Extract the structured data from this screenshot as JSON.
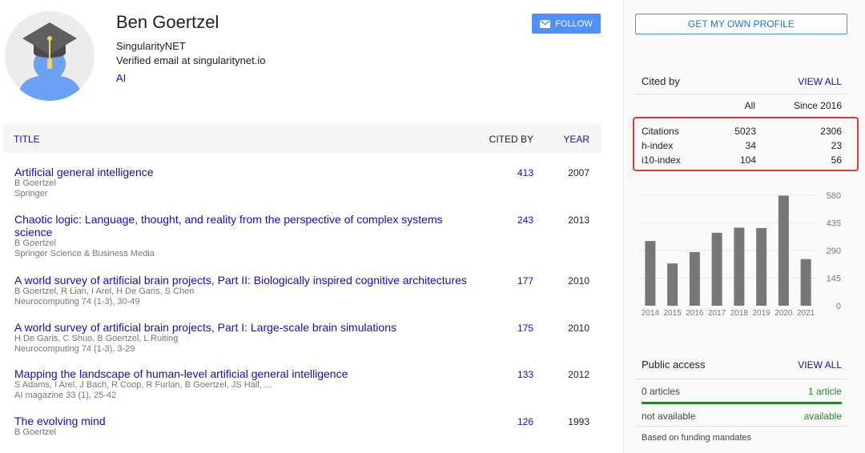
{
  "profile": {
    "name": "Ben Goertzel",
    "affiliation": "SingularityNET",
    "email": "Verified email at singularitynet.io",
    "interest": "AI",
    "follow_label": "FOLLOW"
  },
  "table": {
    "col_title": "TITLE",
    "col_cited": "CITED BY",
    "col_year": "YEAR",
    "articles": [
      {
        "title": "Artificial general intelligence",
        "authors": "B Goertzel",
        "venue": "Springer",
        "cited": "413",
        "year": "2007"
      },
      {
        "title": "Chaotic logic: Language, thought, and reality from the perspective of complex systems science",
        "authors": "B Goertzel",
        "venue": "Springer Science & Business Media",
        "cited": "243",
        "year": "2013"
      },
      {
        "title": "A world survey of artificial brain projects, Part II: Biologically inspired cognitive architectures",
        "authors": "B Goertzel, R Lian, I Arel, H De Garis, S Chen",
        "venue": "Neurocomputing 74 (1-3), 30-49",
        "cited": "177",
        "year": "2010"
      },
      {
        "title": "A world survey of artificial brain projects, Part I: Large-scale brain simulations",
        "authors": "H De Garis, C Shuo, B Goertzel, L Ruiting",
        "venue": "Neurocomputing 74 (1-3), 3-29",
        "cited": "175",
        "year": "2010"
      },
      {
        "title": "Mapping the landscape of human-level artificial general intelligence",
        "authors": "S Adams, I Arel, J Bach, R Coop, R Furlan, B Goertzel, JS Hall, ...",
        "venue": "AI magazine 33 (1), 25-42",
        "cited": "133",
        "year": "2012"
      },
      {
        "title": "The evolving mind",
        "authors": "B Goertzel",
        "venue": "",
        "cited": "126",
        "year": "1993"
      }
    ]
  },
  "sidebar": {
    "get_profile_label": "GET MY OWN PROFILE",
    "cited_by": {
      "title": "Cited by",
      "view_all": "VIEW ALL",
      "col_all": "All",
      "col_since": "Since 2016",
      "rows": [
        {
          "label": "Citations",
          "all": "5023",
          "since": "2306"
        },
        {
          "label": "h-index",
          "all": "34",
          "since": "23"
        },
        {
          "label": "i10-index",
          "all": "104",
          "since": "56"
        }
      ]
    },
    "public_access": {
      "title": "Public access",
      "view_all": "VIEW ALL",
      "left1": "0 articles",
      "right1": "1 article",
      "left2": "not available",
      "right2": "available",
      "footer": "Based on funding mandates",
      "available_fraction": 1.0
    }
  },
  "chart_data": {
    "type": "bar",
    "categories": [
      "2014",
      "2015",
      "2016",
      "2017",
      "2018",
      "2019",
      "2020",
      "2021"
    ],
    "values": [
      340,
      222,
      282,
      383,
      410,
      408,
      578,
      245
    ],
    "ylim": [
      0,
      580
    ],
    "yticks": [
      0,
      145,
      290,
      435,
      580
    ],
    "grid": true,
    "bar_color": "#777777"
  },
  "colors": {
    "link": "#1a0dab",
    "accent": "#4d90fe",
    "highlight": "#e53935",
    "access": "#2e7d32"
  }
}
